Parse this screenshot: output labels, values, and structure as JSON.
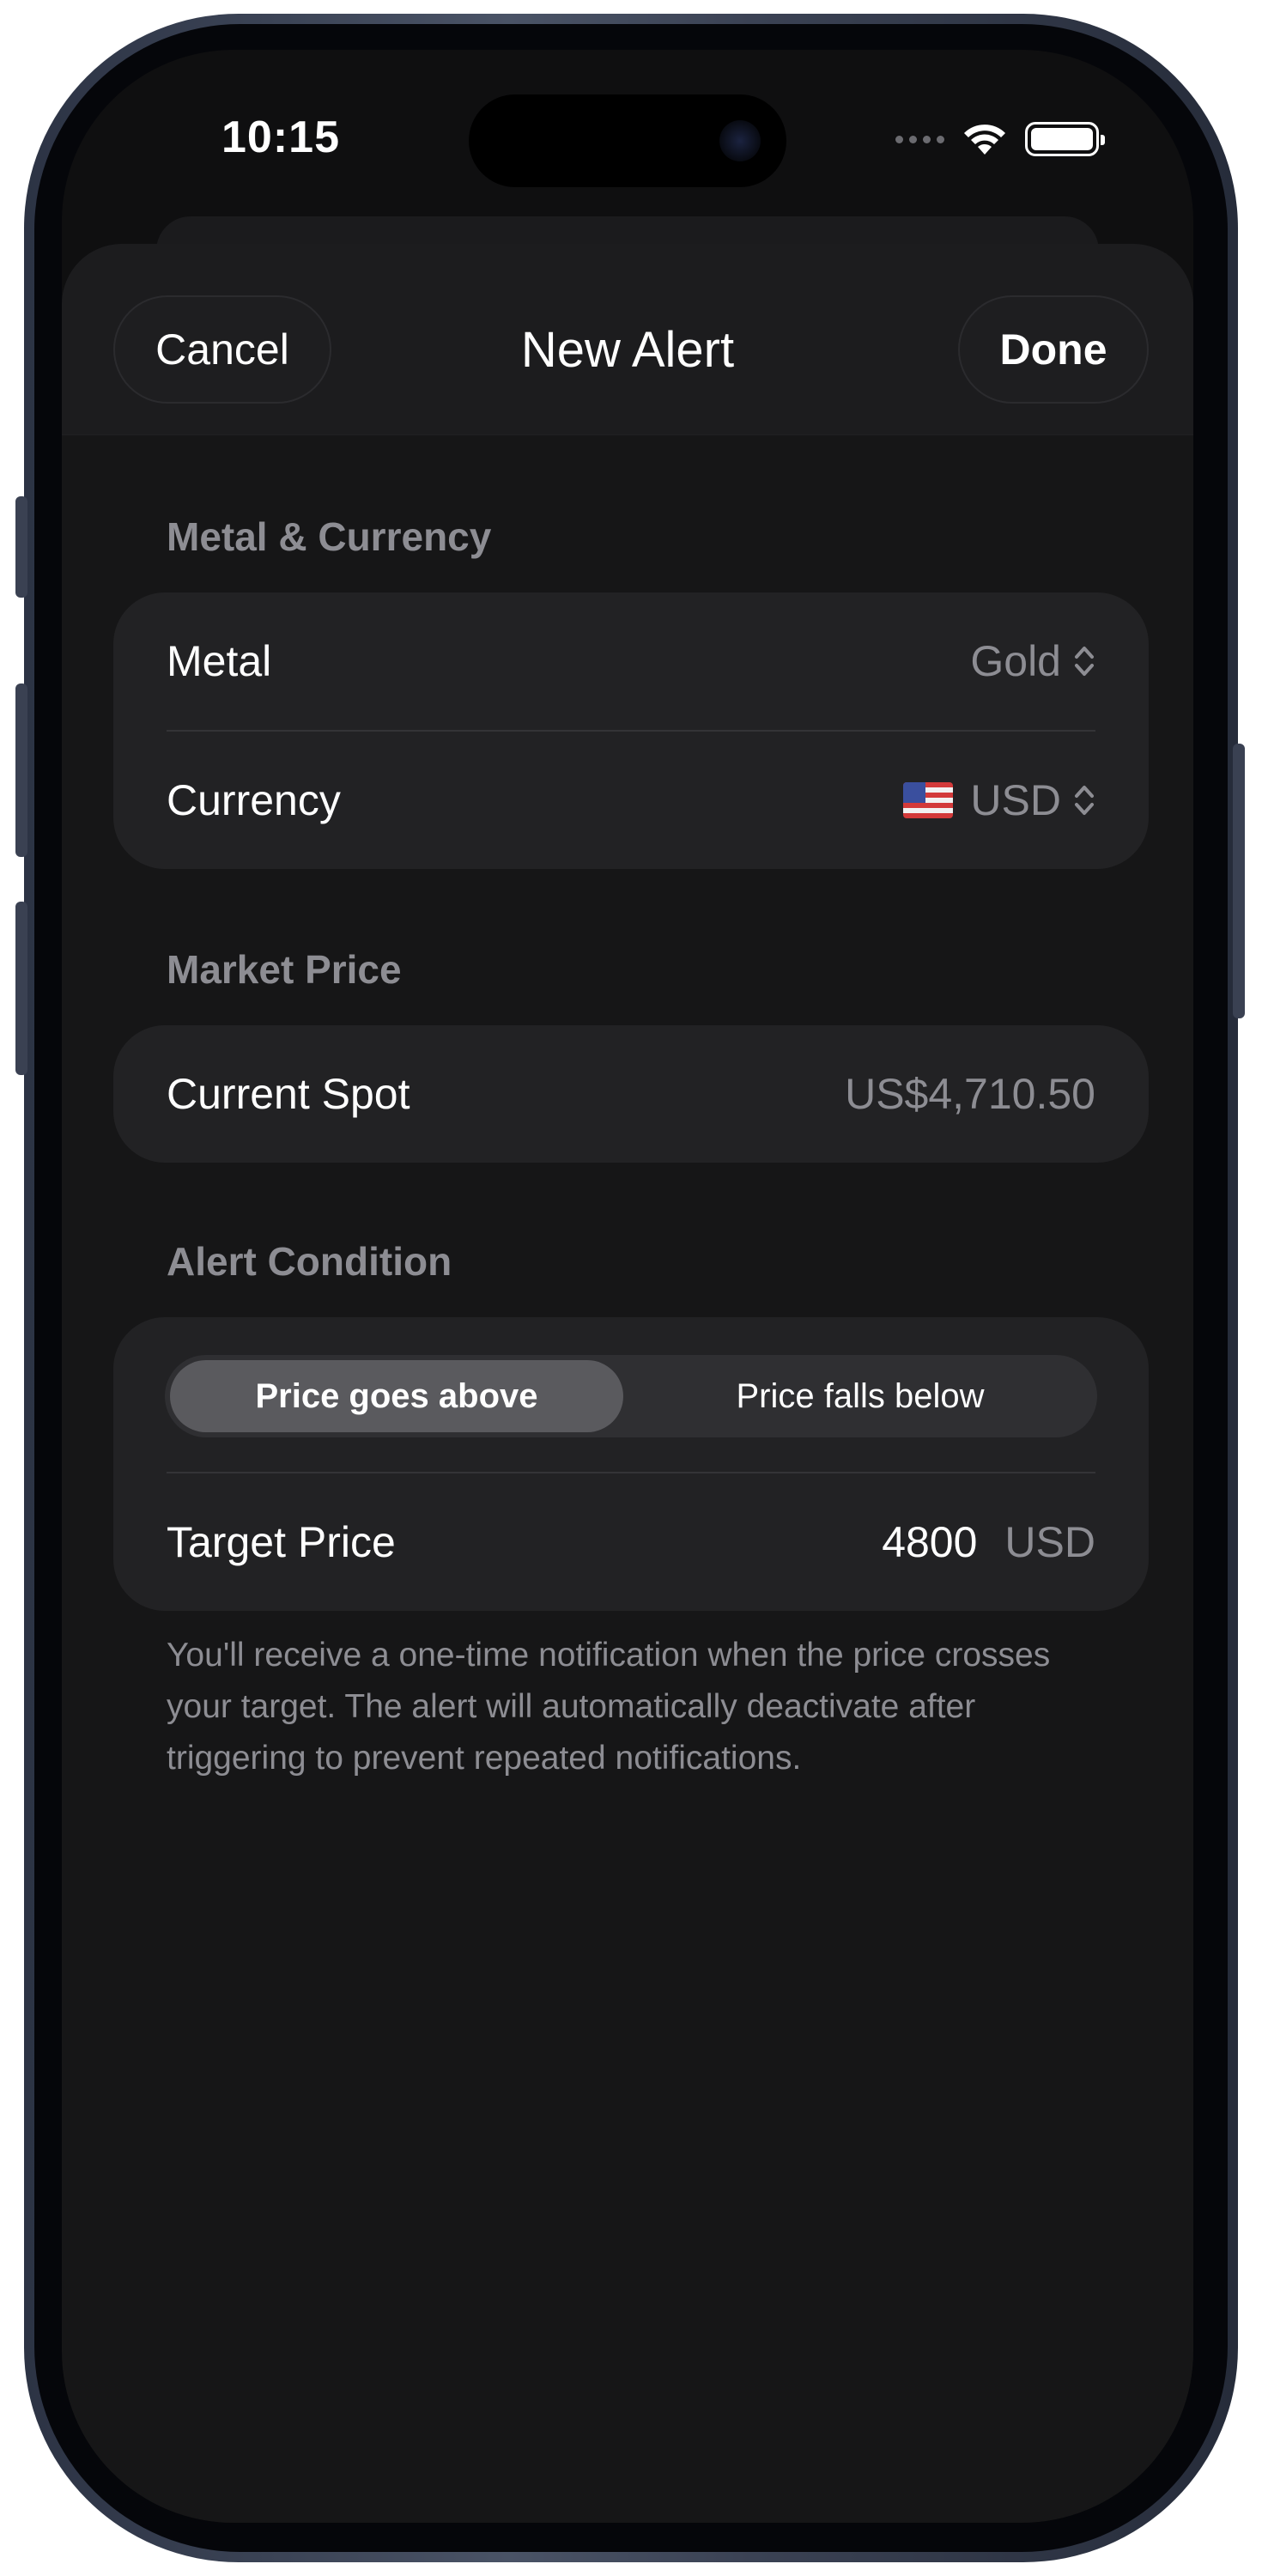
{
  "status_bar": {
    "time": "10:15"
  },
  "nav": {
    "cancel_label": "Cancel",
    "title": "New Alert",
    "done_label": "Done"
  },
  "sections": {
    "metal_currency": {
      "header": "Metal & Currency",
      "metal_label": "Metal",
      "metal_value": "Gold",
      "currency_label": "Currency",
      "currency_value": "USD",
      "currency_flag": "us-flag-icon"
    },
    "market_price": {
      "header": "Market Price",
      "spot_label": "Current Spot",
      "spot_value": "US$4,710.50"
    },
    "alert_condition": {
      "header": "Alert Condition",
      "options": [
        "Price goes above",
        "Price falls below"
      ],
      "selected_option": "Price goes above",
      "target_label": "Target Price",
      "target_value": "4800",
      "target_unit": "USD"
    }
  },
  "footer_note": "You'll receive a one-time notification when the price crosses your target. The alert will automatically deactivate after triggering to prevent repeated notifications.",
  "colors": {
    "background": "#161617",
    "card": "#222224",
    "secondary_text": "#8d8d93",
    "segment_active": "#5a5a5e"
  }
}
